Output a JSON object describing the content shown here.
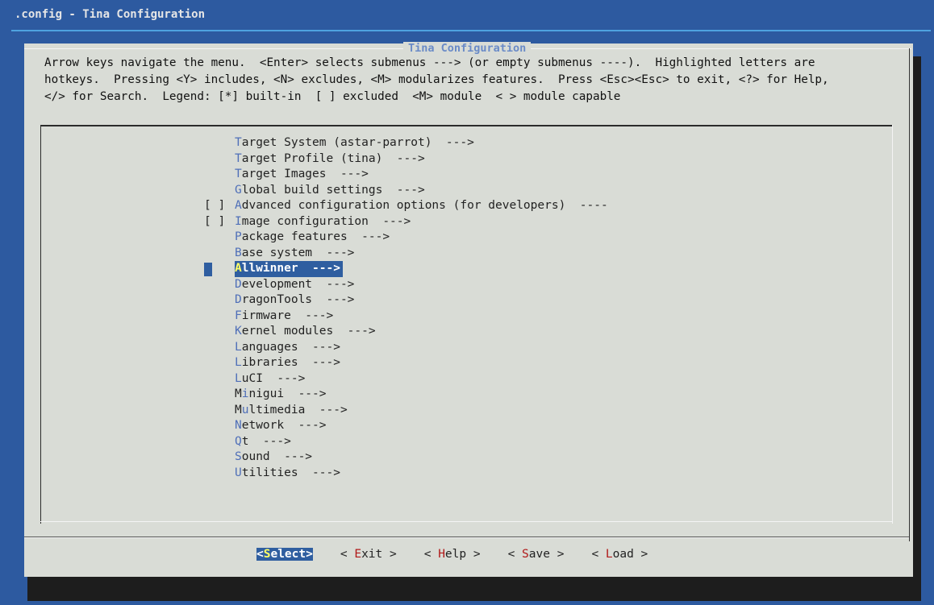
{
  "window": {
    "title": ".config - Tina Configuration"
  },
  "dialog": {
    "title": "Tina Configuration",
    "help_lines": [
      "Arrow keys navigate the menu.  <Enter> selects submenus ---> (or empty submenus ----).  Highlighted letters are",
      "hotkeys.  Pressing <Y> includes, <N> excludes, <M> modularizes features.  Press <Esc><Esc> to exit, <?> for Help,",
      "</> for Search.  Legend: [*] built-in  [ ] excluded  <M> module  < > module capable"
    ]
  },
  "menu": [
    {
      "check": "",
      "hotkey": "T",
      "rest": "arget System (astar-parrot)  --->",
      "selected": false
    },
    {
      "check": "",
      "hotkey": "T",
      "rest": "arget Profile (tina)  --->",
      "selected": false
    },
    {
      "check": "",
      "hotkey": "T",
      "rest": "arget Images  --->",
      "selected": false
    },
    {
      "check": "",
      "hotkey": "G",
      "rest": "lobal build settings  --->",
      "selected": false
    },
    {
      "check": "[ ]",
      "hotkey": "A",
      "rest": "dvanced configuration options (for developers)  ----",
      "selected": false
    },
    {
      "check": "[ ]",
      "hotkey": "I",
      "rest": "mage configuration  --->",
      "selected": false
    },
    {
      "check": "",
      "hotkey": "P",
      "rest": "ackage features  --->",
      "selected": false
    },
    {
      "check": "",
      "hotkey": "B",
      "rest": "ase system  --->",
      "selected": false
    },
    {
      "check": "",
      "hotkey": "A",
      "rest": "llwinner  --->",
      "selected": true
    },
    {
      "check": "",
      "hotkey": "D",
      "rest": "evelopment  --->",
      "selected": false
    },
    {
      "check": "",
      "hotkey": "D",
      "rest": "ragonTools  --->",
      "selected": false
    },
    {
      "check": "",
      "hotkey": "F",
      "rest": "irmware  --->",
      "selected": false
    },
    {
      "check": "",
      "hotkey": "K",
      "rest": "ernel modules  --->",
      "selected": false
    },
    {
      "check": "",
      "hotkey": "L",
      "rest": "anguages  --->",
      "selected": false
    },
    {
      "check": "",
      "hotkey": "L",
      "rest": "ibraries  --->",
      "selected": false
    },
    {
      "check": "",
      "hotkey": "L",
      "rest": "uCI  --->",
      "selected": false
    },
    {
      "check": "",
      "pre": "M",
      "hotkey": "i",
      "rest": "nigui  --->",
      "selected": false
    },
    {
      "check": "",
      "pre": "M",
      "hotkey": "u",
      "rest": "ltimedia  --->",
      "selected": false
    },
    {
      "check": "",
      "hotkey": "N",
      "rest": "etwork  --->",
      "selected": false
    },
    {
      "check": "",
      "hotkey": "Q",
      "rest": "t  --->",
      "selected": false
    },
    {
      "check": "",
      "hotkey": "S",
      "rest": "ound  --->",
      "selected": false
    },
    {
      "check": "",
      "hotkey": "U",
      "rest": "tilities  --->",
      "selected": false
    }
  ],
  "buttons": [
    {
      "pre": "<",
      "hotkey": "S",
      "rest": "elect>",
      "selected": true
    },
    {
      "pre": "< ",
      "hotkey": "E",
      "rest": "xit >",
      "selected": false
    },
    {
      "pre": "< ",
      "hotkey": "H",
      "rest": "elp >",
      "selected": false
    },
    {
      "pre": "< ",
      "hotkey": "S",
      "rest": "ave >",
      "selected": false
    },
    {
      "pre": "< ",
      "hotkey": "L",
      "rest": "oad >",
      "selected": false
    }
  ],
  "colors": {
    "background": "#2d5aa0",
    "dialog": "#d9dcd6",
    "selection": "#2f5ea0",
    "hotkey": "#4f6fb8",
    "button_hotkey": "#b01818"
  }
}
